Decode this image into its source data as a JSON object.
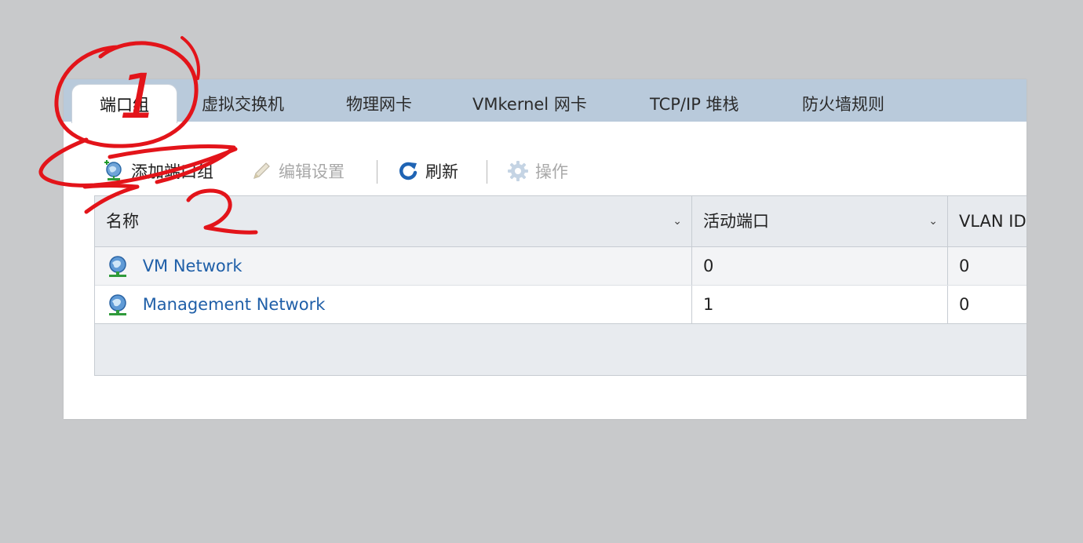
{
  "tabs": [
    {
      "label": "端口组",
      "active": true
    },
    {
      "label": "虚拟交换机",
      "active": false
    },
    {
      "label": "物理网卡",
      "active": false
    },
    {
      "label": "VMkernel 网卡",
      "active": false
    },
    {
      "label": "TCP/IP 堆栈",
      "active": false
    },
    {
      "label": "防火墙规则",
      "active": false
    }
  ],
  "toolbar": {
    "add_label": "添加端口组",
    "add_icon": "add-network-icon",
    "edit_label": "编辑设置",
    "edit_icon": "pencil-icon",
    "edit_disabled": true,
    "refresh_label": "刷新",
    "refresh_icon": "refresh-icon",
    "actions_label": "操作",
    "actions_icon": "gear-icon",
    "actions_disabled": true
  },
  "table": {
    "columns": [
      "名称",
      "活动端口",
      "VLAN ID"
    ],
    "rows": [
      {
        "name": "VM Network",
        "active_ports": "0",
        "vlan_id": "0",
        "icon": "network-globe-icon"
      },
      {
        "name": "Management Network",
        "active_ports": "1",
        "vlan_id": "0",
        "icon": "network-globe-icon"
      }
    ]
  },
  "annotations": {
    "numbers": [
      "1",
      "2"
    ],
    "color": "#e3141a"
  },
  "colors": {
    "tabbar": "#b9cadb",
    "link": "#1f5fa8",
    "background": "#c8c9cb"
  }
}
